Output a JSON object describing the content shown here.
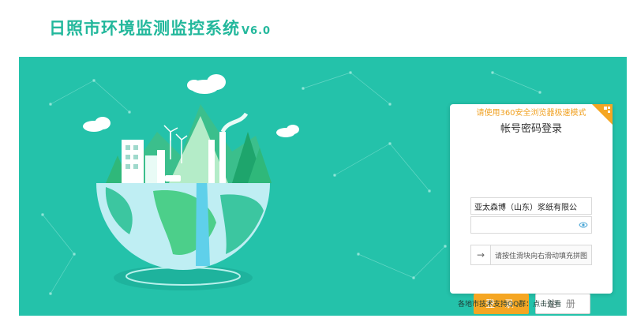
{
  "header": {
    "title": "日照市环境监测监控系统",
    "version": "V6.0"
  },
  "login": {
    "tip": "请使用360安全浏览器极速模式",
    "title": "帐号密码登录",
    "username_value": "亚太森博（山东）浆纸有限公司",
    "password_value": "",
    "slider_text": "请按住滑块向右滑动填充拼图",
    "login_button": "登 录",
    "register_button": "注 册"
  },
  "footer": {
    "support_text": "各地市技术支持QQ群：点击查看"
  },
  "colors": {
    "brand": "#23b89c",
    "hero_bg": "#24c2aa",
    "login_button": "#f5a623",
    "tip": "#f0a020"
  },
  "icons": {
    "eye": "eye-icon",
    "slider_arrow": "arrow-right-icon",
    "qr_corner": "qr-corner-icon"
  }
}
